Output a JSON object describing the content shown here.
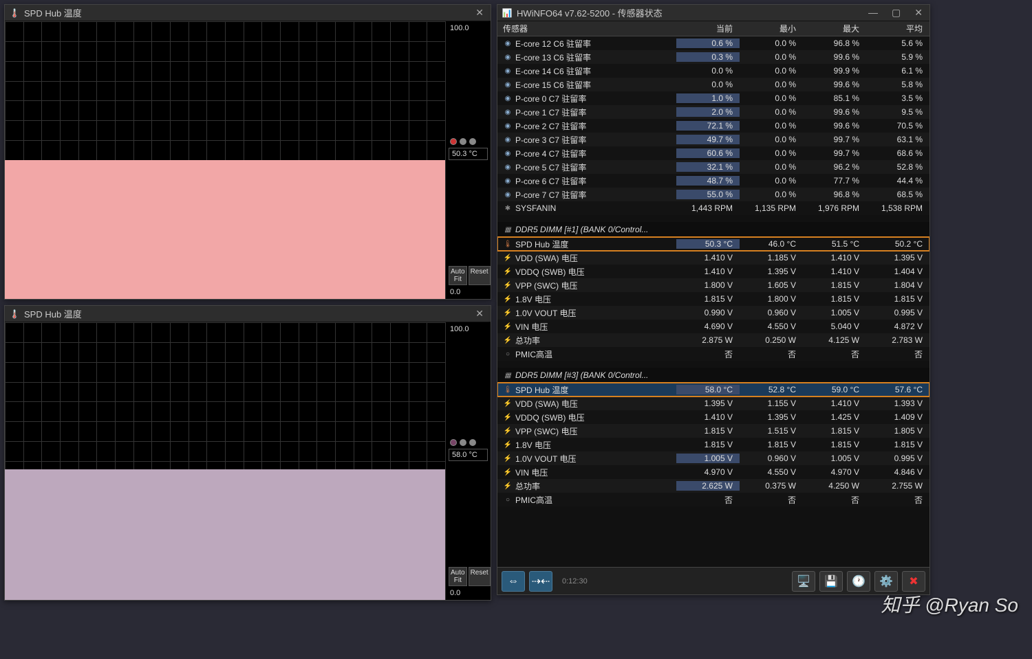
{
  "graph1": {
    "title": "SPD Hub 温度",
    "ymax": "100.0",
    "ymin": "0.0",
    "current": "50.3 °C",
    "fill_color": "#f2a7a7",
    "fill_height_pct": 50,
    "dot_colors": [
      "#cc3333",
      "#888888",
      "#888888"
    ],
    "autofit": "Auto Fit",
    "reset": "Reset"
  },
  "graph2": {
    "title": "SPD Hub 温度",
    "ymax": "100.0",
    "ymin": "0.0",
    "current": "58.0 °C",
    "fill_color": "#bda8bd",
    "fill_height_pct": 47,
    "dot_colors": [
      "#774466",
      "#888888",
      "#888888"
    ],
    "autofit": "Auto Fit",
    "reset": "Reset"
  },
  "sensors": {
    "title": "HWiNFO64 v7.62-5200 - 传感器状态",
    "columns": {
      "name": "传感器",
      "cur": "当前",
      "min": "最小",
      "max": "最大",
      "avg": "平均"
    },
    "rows": [
      {
        "icon": "clock",
        "name": "E-core 12 C6 驻留率",
        "cur": "0.6 %",
        "min": "0.0 %",
        "max": "96.8 %",
        "avg": "5.6 %",
        "cur_hl": true
      },
      {
        "icon": "clock",
        "name": "E-core 13 C6 驻留率",
        "cur": "0.3 %",
        "min": "0.0 %",
        "max": "99.6 %",
        "avg": "5.9 %",
        "cur_hl": true
      },
      {
        "icon": "clock",
        "name": "E-core 14 C6 驻留率",
        "cur": "0.0 %",
        "min": "0.0 %",
        "max": "99.9 %",
        "avg": "6.1 %"
      },
      {
        "icon": "clock",
        "name": "E-core 15 C6 驻留率",
        "cur": "0.0 %",
        "min": "0.0 %",
        "max": "99.6 %",
        "avg": "5.8 %"
      },
      {
        "icon": "clock",
        "name": "P-core 0 C7 驻留率",
        "cur": "1.0 %",
        "min": "0.0 %",
        "max": "85.1 %",
        "avg": "3.5 %",
        "cur_hl": true
      },
      {
        "icon": "clock",
        "name": "P-core 1 C7 驻留率",
        "cur": "2.0 %",
        "min": "0.0 %",
        "max": "99.6 %",
        "avg": "9.5 %",
        "cur_hl": true
      },
      {
        "icon": "clock",
        "name": "P-core 2 C7 驻留率",
        "cur": "72.1 %",
        "min": "0.0 %",
        "max": "99.6 %",
        "avg": "70.5 %",
        "cur_hl": true
      },
      {
        "icon": "clock",
        "name": "P-core 3 C7 驻留率",
        "cur": "49.7 %",
        "min": "0.0 %",
        "max": "99.7 %",
        "avg": "63.1 %",
        "cur_hl": true
      },
      {
        "icon": "clock",
        "name": "P-core 4 C7 驻留率",
        "cur": "60.6 %",
        "min": "0.0 %",
        "max": "99.7 %",
        "avg": "68.6 %",
        "cur_hl": true
      },
      {
        "icon": "clock",
        "name": "P-core 5 C7 驻留率",
        "cur": "32.1 %",
        "min": "0.0 %",
        "max": "96.2 %",
        "avg": "52.8 %",
        "cur_hl": true
      },
      {
        "icon": "clock",
        "name": "P-core 6 C7 驻留率",
        "cur": "48.7 %",
        "min": "0.0 %",
        "max": "77.7 %",
        "avg": "44.4 %",
        "cur_hl": true
      },
      {
        "icon": "clock",
        "name": "P-core 7 C7 驻留率",
        "cur": "55.0 %",
        "min": "0.0 %",
        "max": "96.8 %",
        "avg": "68.5 %",
        "cur_hl": true
      },
      {
        "icon": "fan",
        "name": "SYSFANIN",
        "cur": "1,443 RPM",
        "min": "1,135 RPM",
        "max": "1,976 RPM",
        "avg": "1,538 RPM"
      },
      {
        "section": true,
        "icon": "chip",
        "name": "DDR5 DIMM [#1] (BANK 0/Control..."
      },
      {
        "icon": "therm",
        "name": "SPD Hub 温度",
        "cur": "50.3 °C",
        "min": "46.0 °C",
        "max": "51.5 °C",
        "avg": "50.2 °C",
        "highlight": true,
        "cur_hl": true
      },
      {
        "icon": "bolt",
        "name": "VDD (SWA) 电压",
        "cur": "1.410 V",
        "min": "1.185 V",
        "max": "1.410 V",
        "avg": "1.395 V"
      },
      {
        "icon": "bolt",
        "name": "VDDQ (SWB) 电压",
        "cur": "1.410 V",
        "min": "1.395 V",
        "max": "1.410 V",
        "avg": "1.404 V"
      },
      {
        "icon": "bolt",
        "name": "VPP (SWC) 电压",
        "cur": "1.800 V",
        "min": "1.605 V",
        "max": "1.815 V",
        "avg": "1.804 V"
      },
      {
        "icon": "bolt",
        "name": "1.8V 电压",
        "cur": "1.815 V",
        "min": "1.800 V",
        "max": "1.815 V",
        "avg": "1.815 V"
      },
      {
        "icon": "bolt",
        "name": "1.0V VOUT 电压",
        "cur": "0.990 V",
        "min": "0.960 V",
        "max": "1.005 V",
        "avg": "0.995 V"
      },
      {
        "icon": "bolt",
        "name": "VIN 电压",
        "cur": "4.690 V",
        "min": "4.550 V",
        "max": "5.040 V",
        "avg": "4.872 V"
      },
      {
        "icon": "bolt",
        "name": "总功率",
        "cur": "2.875 W",
        "min": "0.250 W",
        "max": "4.125 W",
        "avg": "2.783 W"
      },
      {
        "icon": "dot",
        "name": "PMIC高温",
        "cur": "否",
        "min": "否",
        "max": "否",
        "avg": "否"
      },
      {
        "section": true,
        "icon": "chip",
        "name": "DDR5 DIMM [#3] (BANK 0/Control..."
      },
      {
        "icon": "therm",
        "name": "SPD Hub 温度",
        "cur": "58.0 °C",
        "min": "52.8 °C",
        "max": "59.0 °C",
        "avg": "57.6 °C",
        "highlight": true,
        "selected": true,
        "cur_hl": true
      },
      {
        "icon": "bolt",
        "name": "VDD (SWA) 电压",
        "cur": "1.395 V",
        "min": "1.155 V",
        "max": "1.410 V",
        "avg": "1.393 V"
      },
      {
        "icon": "bolt",
        "name": "VDDQ (SWB) 电压",
        "cur": "1.410 V",
        "min": "1.395 V",
        "max": "1.425 V",
        "avg": "1.409 V"
      },
      {
        "icon": "bolt",
        "name": "VPP (SWC) 电压",
        "cur": "1.815 V",
        "min": "1.515 V",
        "max": "1.815 V",
        "avg": "1.805 V"
      },
      {
        "icon": "bolt",
        "name": "1.8V 电压",
        "cur": "1.815 V",
        "min": "1.815 V",
        "max": "1.815 V",
        "avg": "1.815 V"
      },
      {
        "icon": "bolt",
        "name": "1.0V VOUT 电压",
        "cur": "1.005 V",
        "min": "0.960 V",
        "max": "1.005 V",
        "avg": "0.995 V",
        "cur_hl": true
      },
      {
        "icon": "bolt",
        "name": "VIN 电压",
        "cur": "4.970 V",
        "min": "4.550 V",
        "max": "4.970 V",
        "avg": "4.846 V"
      },
      {
        "icon": "bolt",
        "name": "总功率",
        "cur": "2.625 W",
        "min": "0.375 W",
        "max": "4.250 W",
        "avg": "2.755 W",
        "cur_hl": true
      },
      {
        "icon": "dot",
        "name": "PMIC高温",
        "cur": "否",
        "min": "否",
        "max": "否",
        "avg": "否"
      }
    ],
    "timer": "0:12:30"
  },
  "watermark": "知乎 @Ryan So"
}
